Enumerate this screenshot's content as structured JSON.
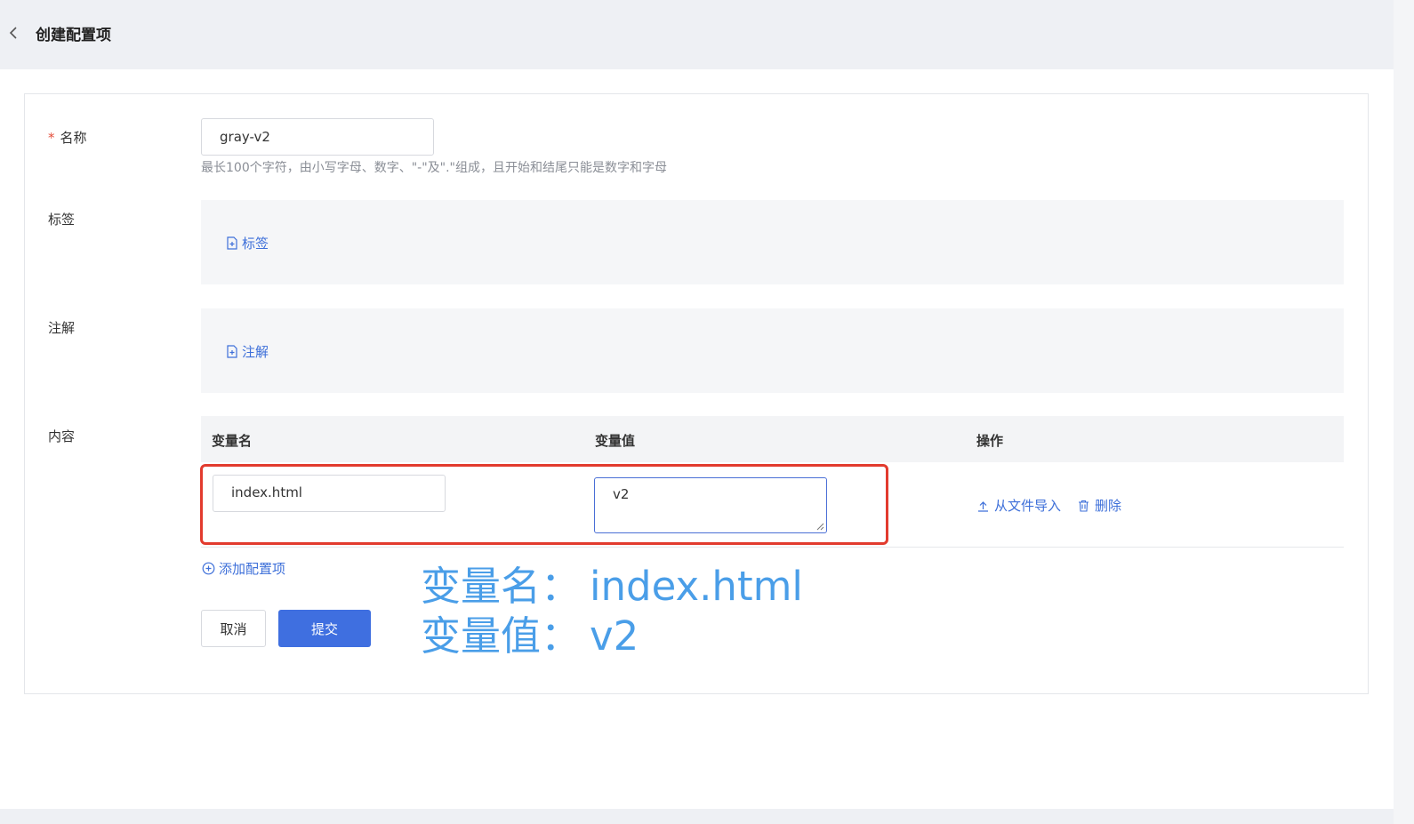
{
  "header": {
    "title": "创建配置项"
  },
  "form": {
    "name": {
      "label": "名称",
      "required_mark": "*",
      "value": "gray-v2",
      "hint": "最长100个字符，由小写字母、数字、\"-\"及\".\"组成，且开始和结尾只能是数字和字母"
    },
    "tags": {
      "label": "标签",
      "add_label": "标签"
    },
    "annotations": {
      "label": "注解",
      "add_label": "注解"
    },
    "content": {
      "label": "内容",
      "columns": [
        "变量名",
        "变量值",
        "操作"
      ],
      "rows": [
        {
          "var_name": "index.html",
          "var_value": "v2",
          "actions": {
            "import": "从文件导入",
            "delete": "删除"
          }
        }
      ],
      "add_item_label": "添加配置项"
    },
    "buttons": {
      "cancel": "取消",
      "submit": "提交"
    }
  },
  "annotation_overlay": {
    "line1_prefix": "变量名：",
    "line1_value": "index.html",
    "line2_prefix": "变量值：",
    "line2_value": "v2"
  },
  "colors": {
    "accent": "#3d6fd9",
    "primary_button": "#3f6fe0",
    "highlight": "#e23b2e",
    "annotation": "#4a9ee8"
  }
}
